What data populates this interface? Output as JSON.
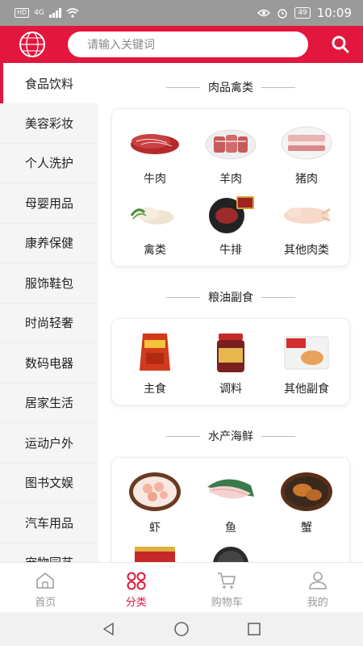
{
  "statusbar": {
    "network_tag": "HD",
    "network_type": "4G",
    "battery": "49",
    "time": "10:09"
  },
  "header": {
    "search_placeholder": "请输入关键词"
  },
  "sidebar": {
    "items": [
      {
        "label": "食品饮料",
        "active": true
      },
      {
        "label": "美容彩妆"
      },
      {
        "label": "个人洗护"
      },
      {
        "label": "母婴用品"
      },
      {
        "label": "康养保健"
      },
      {
        "label": "服饰鞋包"
      },
      {
        "label": "时尚轻奢"
      },
      {
        "label": "数码电器"
      },
      {
        "label": "居家生活"
      },
      {
        "label": "运动户外"
      },
      {
        "label": "图书文娱"
      },
      {
        "label": "汽车用品"
      },
      {
        "label": "宠物园艺"
      }
    ]
  },
  "sections": [
    {
      "title": "肉品禽类",
      "items": [
        "牛肉",
        "羊肉",
        "猪肉",
        "禽类",
        "牛排",
        "其他肉类"
      ]
    },
    {
      "title": "粮油副食",
      "items": [
        "主食",
        "调料",
        "其他副食"
      ]
    },
    {
      "title": "水产海鲜",
      "items": [
        "虾",
        "鱼",
        "蟹"
      ]
    }
  ],
  "bottomnav": {
    "items": [
      {
        "label": "首页",
        "icon": "home-icon"
      },
      {
        "label": "分类",
        "icon": "category-icon",
        "active": true
      },
      {
        "label": "购物车",
        "icon": "cart-icon"
      },
      {
        "label": "我的",
        "icon": "user-icon"
      }
    ]
  },
  "colors": {
    "brand": "#e3163d",
    "statusbar": "#9a9a9a"
  }
}
